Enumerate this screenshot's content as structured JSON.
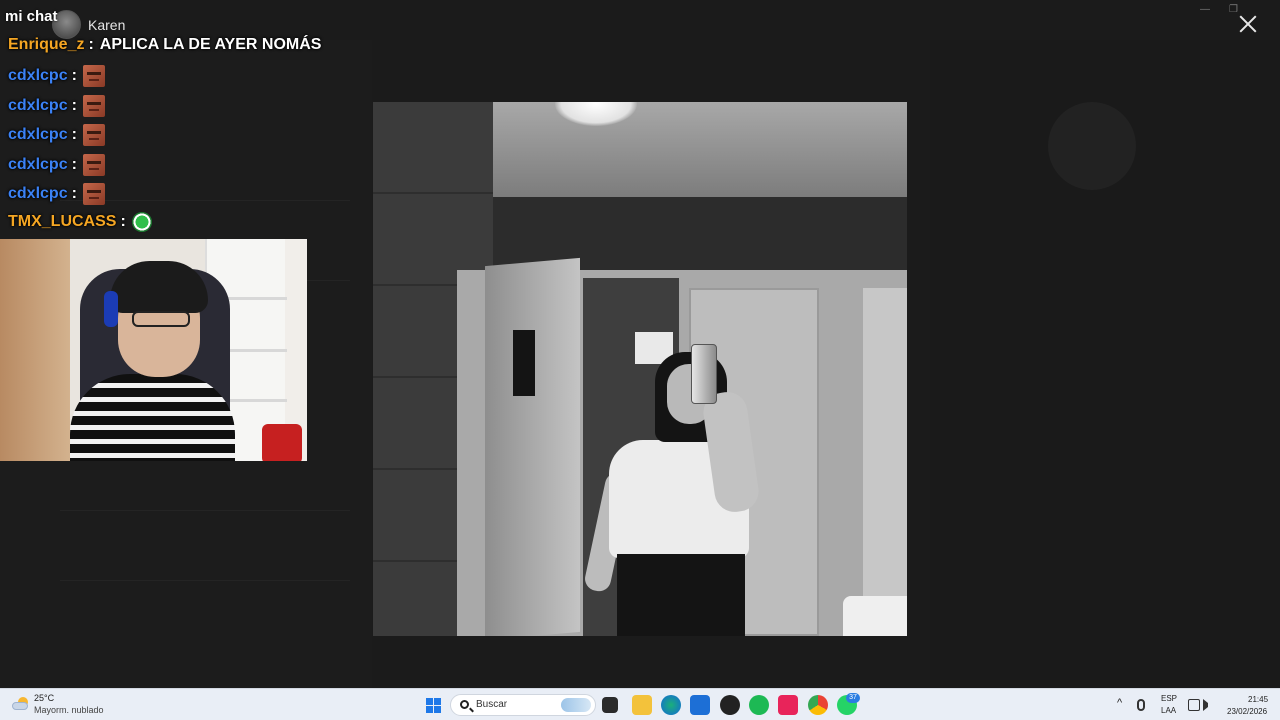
{
  "viewer": {
    "contact_name": "Karen"
  },
  "chat": {
    "title": "mi chat",
    "messages": [
      {
        "user": "Enrique_z",
        "sep": ":",
        "text": "APLICA LA DE AYER NOMÁS",
        "user_color": "#f5a623",
        "emote": null
      },
      {
        "user": "cdxlcpc",
        "sep": ":",
        "text": "",
        "user_color": "#3b82f6",
        "emote": "face-emote"
      },
      {
        "user": "cdxlcpc",
        "sep": ":",
        "text": "",
        "user_color": "#3b82f6",
        "emote": "face-emote"
      },
      {
        "user": "cdxlcpc",
        "sep": ":",
        "text": "",
        "user_color": "#3b82f6",
        "emote": "face-emote"
      },
      {
        "user": "cdxlcpc",
        "sep": ":",
        "text": "",
        "user_color": "#3b82f6",
        "emote": "face-emote"
      },
      {
        "user": "TMX_LUCASS",
        "sep": ":",
        "text": "",
        "user_color": "#f5a623",
        "emote": "globe-emote"
      }
    ]
  },
  "taskbar": {
    "weather": {
      "temp": "25°C",
      "condition": "Mayorm. nublado",
      "icon": "partly-cloudy-icon"
    },
    "search_placeholder": "Buscar",
    "language": {
      "line1": "ESP",
      "line2": "LAA"
    },
    "clock": {
      "time": "21:45",
      "date": "23/02/2026"
    },
    "whatsapp_badge": "37",
    "apps": [
      "task-view-icon",
      "file-explorer-icon",
      "edge-icon",
      "store-icon",
      "obs-icon",
      "spotify-icon",
      "tiktok-icon",
      "chrome-icon",
      "whatsapp-icon"
    ]
  },
  "colors": {
    "accent": "#1e78e8",
    "chat_orange": "#f5a623",
    "chat_blue": "#3b82f6"
  }
}
